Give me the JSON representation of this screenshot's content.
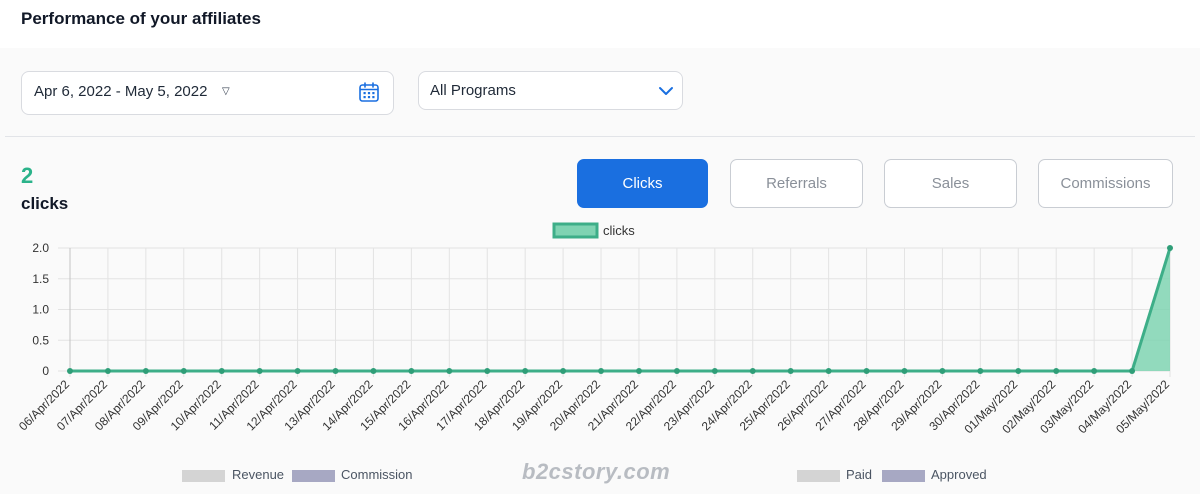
{
  "header": {
    "title": "Performance of your affiliates"
  },
  "filters": {
    "date_range": "Apr 6, 2022 - May 5, 2022",
    "date_caret_icon": "caret-down-icon",
    "calendar_icon": "calendar-icon",
    "program": "All Programs",
    "program_chevron_icon": "chevron-down-icon"
  },
  "summary": {
    "value": "2",
    "label": "clicks"
  },
  "metric_tabs": [
    {
      "label": "Clicks",
      "active": true
    },
    {
      "label": "Referrals",
      "active": false
    },
    {
      "label": "Sales",
      "active": false
    },
    {
      "label": "Commissions",
      "active": false
    }
  ],
  "chart_data": {
    "type": "area",
    "x": [
      "06/Apr/2022",
      "07/Apr/2022",
      "08/Apr/2022",
      "09/Apr/2022",
      "10/Apr/2022",
      "11/Apr/2022",
      "12/Apr/2022",
      "13/Apr/2022",
      "14/Apr/2022",
      "15/Apr/2022",
      "16/Apr/2022",
      "17/Apr/2022",
      "18/Apr/2022",
      "19/Apr/2022",
      "20/Apr/2022",
      "21/Apr/2022",
      "22/Apr/2022",
      "23/Apr/2022",
      "24/Apr/2022",
      "25/Apr/2022",
      "26/Apr/2022",
      "27/Apr/2022",
      "28/Apr/2022",
      "29/Apr/2022",
      "30/Apr/2022",
      "01/May/2022",
      "02/May/2022",
      "03/May/2022",
      "04/May/2022",
      "05/May/2022"
    ],
    "series": [
      {
        "name": "clicks",
        "values": [
          0,
          0,
          0,
          0,
          0,
          0,
          0,
          0,
          0,
          0,
          0,
          0,
          0,
          0,
          0,
          0,
          0,
          0,
          0,
          0,
          0,
          0,
          0,
          0,
          0,
          0,
          0,
          0,
          0,
          2
        ]
      }
    ],
    "y_ticks": [
      "2.0",
      "1.5",
      "1.0",
      "0.5",
      "0"
    ],
    "ylim": [
      0,
      2
    ],
    "grid": true,
    "legend_position": "top-center",
    "colors": {
      "line": "#3dae88",
      "fill": "#7fd3b2",
      "point": "#2f9e78"
    }
  },
  "bottom_legend": [
    {
      "label": "Revenue",
      "color": "#d4d4d4"
    },
    {
      "label": "Commission",
      "color": "#a7a8c3"
    },
    {
      "label": "Paid",
      "color": "#d4d4d4"
    },
    {
      "label": "Approved",
      "color": "#a7a8c3"
    }
  ],
  "watermark": "b2cstory.com"
}
